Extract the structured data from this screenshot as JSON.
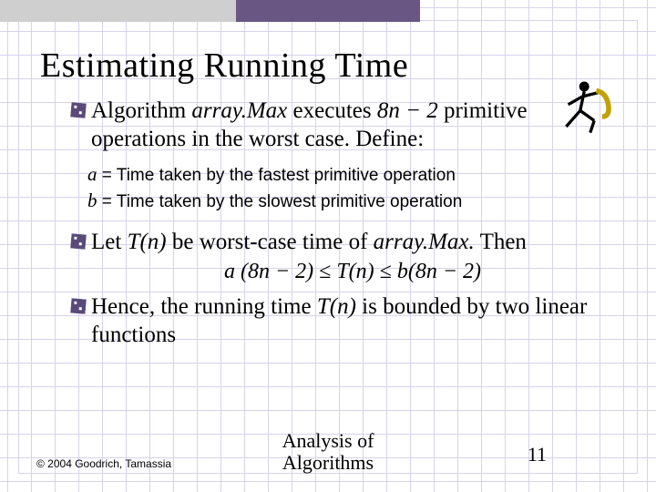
{
  "slide": {
    "title": "Estimating Running Time"
  },
  "bullets": {
    "b1_pre": "Algorithm ",
    "b1_alg": "array.Max",
    "b1_mid": " executes ",
    "b1_expr": "8n − 2",
    "b1_post": " primitive operations in the worst case.  Define:",
    "sub_a_var": "a",
    "sub_a_txt": " = Time taken by the fastest primitive operation",
    "sub_b_var": "b",
    "sub_b_txt": " = Time taken by the slowest primitive operation",
    "b2_pre": "Let ",
    "b2_tn": "T(n)",
    "b2_mid": " be worst-case time of ",
    "b2_alg": "array.Max.",
    "b2_post": " Then",
    "eq_a": "a",
    "eq_l": " (8n − 2) ≤ ",
    "eq_tn": "T(n)",
    "eq_r": " ≤ ",
    "eq_b": "b",
    "eq_end": "(8n − 2)",
    "b3_pre": "Hence, the running time ",
    "b3_tn": "T(n)",
    "b3_post": " is bounded by two linear functions"
  },
  "footer": {
    "copyright": "© 2004 Goodrich, Tamassia",
    "title_l1": "Analysis of",
    "title_l2": "Algorithms",
    "page": "11"
  },
  "icons": {
    "runner": "runner-with-tape-icon"
  }
}
